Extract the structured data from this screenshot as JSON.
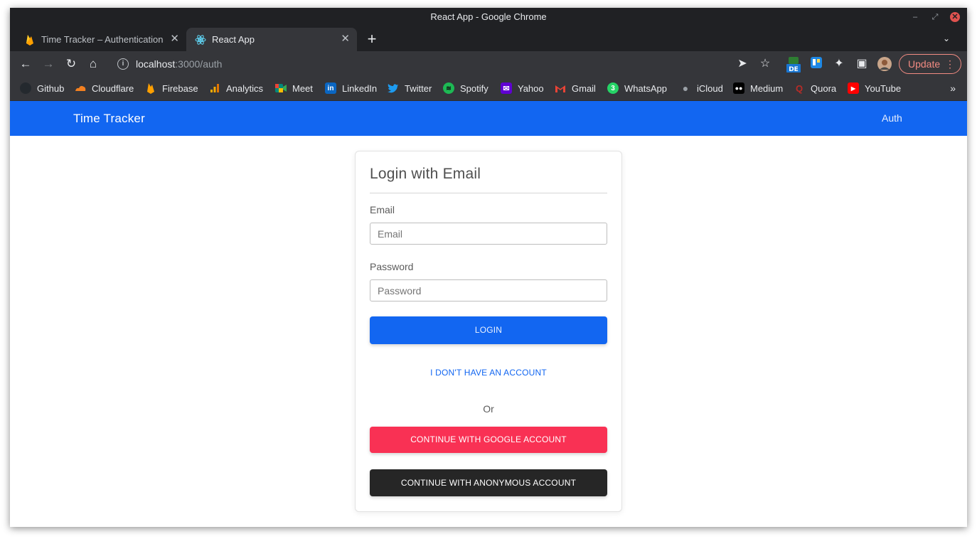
{
  "browser": {
    "window_title": "React App - Google Chrome",
    "tabs": [
      {
        "label": "Time Tracker – Authentication",
        "icon": "firebase-icon"
      },
      {
        "label": "React App",
        "icon": "react-icon"
      }
    ],
    "url_host": "localhost",
    "url_path": ":3000/auth",
    "update_label": "Update",
    "bookmarks": [
      {
        "label": "Github",
        "icon": "github-icon"
      },
      {
        "label": "Cloudflare",
        "icon": "cloudflare-icon"
      },
      {
        "label": "Firebase",
        "icon": "firebase-icon"
      },
      {
        "label": "Analytics",
        "icon": "analytics-icon"
      },
      {
        "label": "Meet",
        "icon": "meet-icon"
      },
      {
        "label": "LinkedIn",
        "icon": "linkedin-icon"
      },
      {
        "label": "Twitter",
        "icon": "twitter-icon"
      },
      {
        "label": "Spotify",
        "icon": "spotify-icon"
      },
      {
        "label": "Yahoo",
        "icon": "yahoo-icon"
      },
      {
        "label": "Gmail",
        "icon": "gmail-icon"
      },
      {
        "label": "WhatsApp",
        "icon": "whatsapp-icon"
      },
      {
        "label": "iCloud",
        "icon": "apple-icon"
      },
      {
        "label": "Medium",
        "icon": "medium-icon"
      },
      {
        "label": "Quora",
        "icon": "quora-icon"
      },
      {
        "label": "YouTube",
        "icon": "youtube-icon"
      }
    ]
  },
  "navbar": {
    "brand": "Time Tracker",
    "auth_link": "Auth",
    "color": "#1266f1"
  },
  "login": {
    "title": "Login with Email",
    "email_label": "Email",
    "email_placeholder": "Email",
    "password_label": "Password",
    "password_placeholder": "Password",
    "login_button": "LOGIN",
    "no_account_link": "I DON'T HAVE AN ACCOUNT",
    "or_text": "Or",
    "google_button": "CONTINUE WITH GOOGLE ACCOUNT",
    "anonymous_button": "CONTINUE WITH ANONYMOUS ACCOUNT",
    "colors": {
      "primary": "#1266f1",
      "google": "#f93154",
      "anonymous": "#262626"
    }
  }
}
